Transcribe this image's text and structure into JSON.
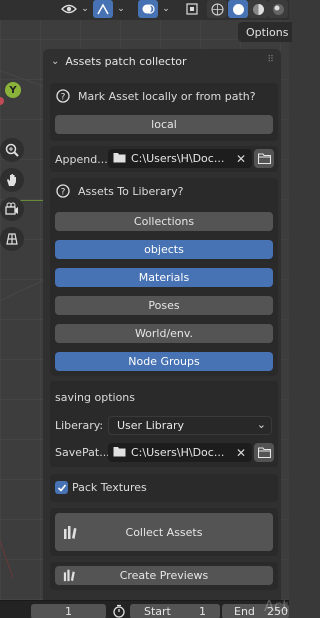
{
  "toolbar": {
    "options_tab": "Options",
    "icons": [
      "eye-icon",
      "gizmo-icon",
      "overlay-icon",
      "xray-icon",
      "wireframe-shading-icon",
      "solid-shading-icon",
      "material-shading-icon",
      "rendered-shading-icon"
    ]
  },
  "gizmo": {
    "y_axis": "Y"
  },
  "panel": {
    "title": "Assets patch collector",
    "mark_section": {
      "title": "Mark Asset locally or from path?",
      "button": "local"
    },
    "append": {
      "label": "Append...",
      "path": "C:\\Users\\H\\Doc..."
    },
    "assets_section": {
      "title": "Assets To Liberary?",
      "buttons": [
        {
          "label": "Collections",
          "active": false
        },
        {
          "label": "objects",
          "active": true
        },
        {
          "label": "Materials",
          "active": true
        },
        {
          "label": "Poses",
          "active": false
        },
        {
          "label": "World/env.",
          "active": false
        },
        {
          "label": "Node Groups",
          "active": true
        }
      ]
    },
    "saving": {
      "title": "saving options",
      "library_label": "Liberary:",
      "library_value": "User Library",
      "savepath_label": "SavePat...",
      "savepath_value": "C:\\Users\\H\\Doc..."
    },
    "pack_textures": {
      "label": "Pack Textures",
      "checked": true
    },
    "collect_button": "Collect Assets",
    "previews_button": "Create Previews"
  },
  "timeline": {
    "current_frame": "1",
    "start_label": "Start",
    "start_value": "1",
    "end_label": "End",
    "end_value": "250"
  },
  "watermark": "Act"
}
